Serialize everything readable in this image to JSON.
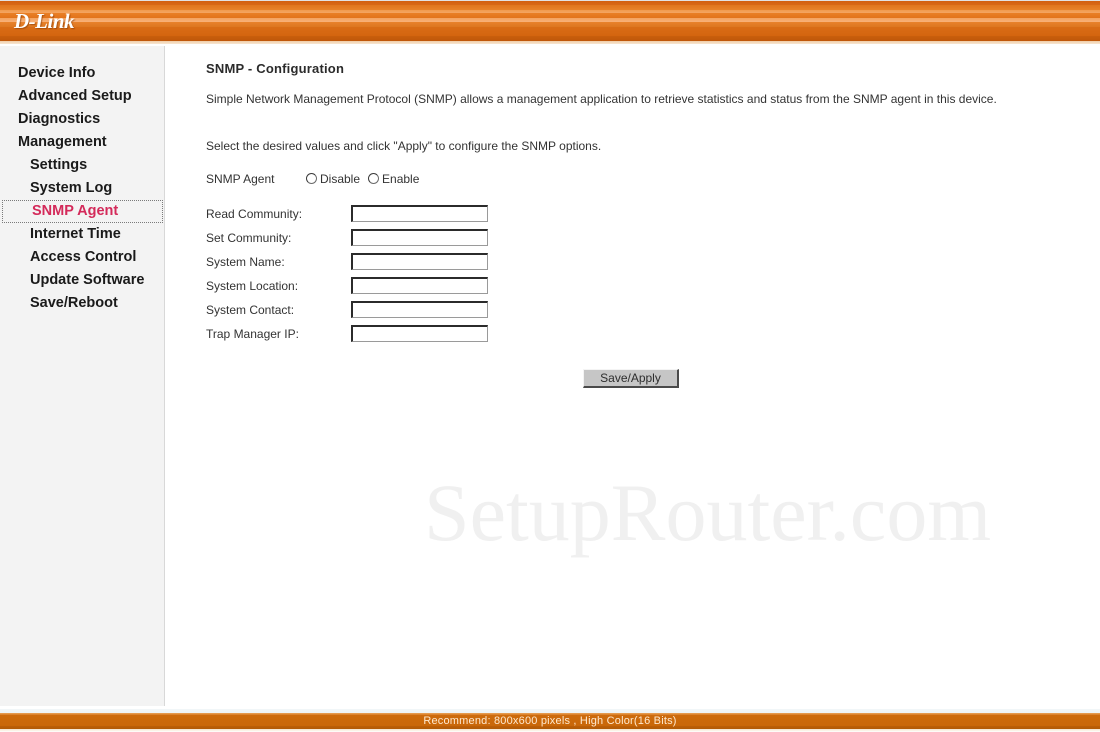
{
  "brand": {
    "logo_text": "D-Link"
  },
  "sidebar": {
    "items": [
      {
        "label": "Device Info",
        "level": 0,
        "active": false
      },
      {
        "label": "Advanced Setup",
        "level": 0,
        "active": false
      },
      {
        "label": "Diagnostics",
        "level": 0,
        "active": false
      },
      {
        "label": "Management",
        "level": 0,
        "active": false
      },
      {
        "label": "Settings",
        "level": 1,
        "active": false
      },
      {
        "label": "System Log",
        "level": 1,
        "active": false
      },
      {
        "label": "SNMP Agent",
        "level": 1,
        "active": true
      },
      {
        "label": "Internet Time",
        "level": 1,
        "active": false
      },
      {
        "label": "Access Control",
        "level": 1,
        "active": false
      },
      {
        "label": "Update Software",
        "level": 1,
        "active": false
      },
      {
        "label": "Save/Reboot",
        "level": 1,
        "active": false
      }
    ]
  },
  "main": {
    "title": "SNMP - Configuration",
    "intro": "Simple Network Management Protocol (SNMP) allows a management application to retrieve statistics and status from the SNMP agent in this device.",
    "instruction": "Select the desired values and click \"Apply\" to configure the SNMP options.",
    "agent": {
      "label": "SNMP Agent",
      "options": [
        {
          "label": "Disable",
          "selected": false
        },
        {
          "label": "Enable",
          "selected": false
        }
      ]
    },
    "fields": [
      {
        "label": "Read Community:",
        "value": "",
        "placeholder": ""
      },
      {
        "label": "Set Community:",
        "value": "",
        "placeholder": ""
      },
      {
        "label": "System Name:",
        "value": "",
        "placeholder": ""
      },
      {
        "label": "System Location:",
        "value": "",
        "placeholder": ""
      },
      {
        "label": "System Contact:",
        "value": "",
        "placeholder": ""
      },
      {
        "label": "Trap Manager IP:",
        "value": "",
        "placeholder": ""
      }
    ],
    "save_label": "Save/Apply"
  },
  "watermark": {
    "text": "SetupRouter.com"
  },
  "footer": {
    "text": "Recommend: 800x600 pixels , High Color(16 Bits)"
  },
  "colors": {
    "header_orange": "#d96916",
    "footer_orange": "#c96709",
    "active_nav": "#d42a5a",
    "sidebar_bg": "#f3f3f3",
    "watermark": "#f0f0f0"
  }
}
